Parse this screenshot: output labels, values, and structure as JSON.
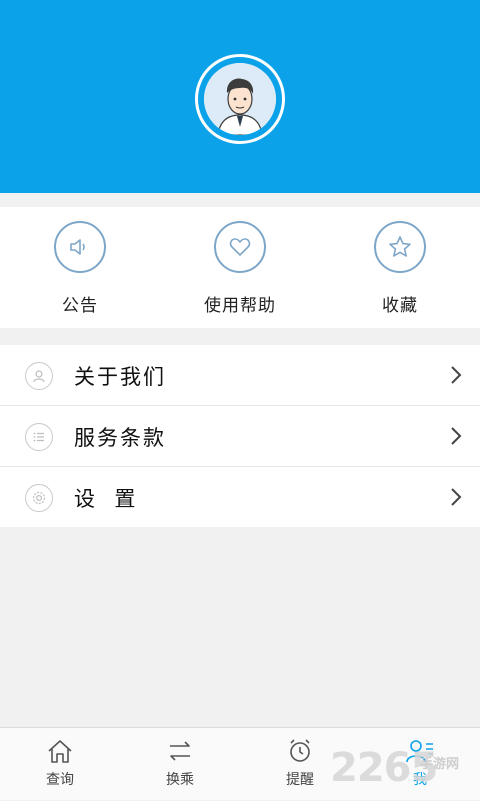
{
  "quick_actions": [
    {
      "label": "公告",
      "icon": "speaker-icon"
    },
    {
      "label": "使用帮助",
      "icon": "heart-icon"
    },
    {
      "label": "收藏",
      "icon": "star-icon"
    }
  ],
  "menu": [
    {
      "label": "关于我们",
      "icon": "about-icon"
    },
    {
      "label": "服务条款",
      "icon": "list-icon"
    },
    {
      "label": "设  置",
      "icon": "gear-icon"
    }
  ],
  "tabs": [
    {
      "label": "查询",
      "icon": "home-icon",
      "active": false
    },
    {
      "label": "换乘",
      "icon": "transfer-icon",
      "active": false
    },
    {
      "label": "提醒",
      "icon": "alarm-icon",
      "active": false
    },
    {
      "label": "我",
      "icon": "profile-icon",
      "active": true
    }
  ],
  "watermark": {
    "number": "2265",
    "site": "手游网"
  },
  "colors": {
    "header": "#0ba2ea",
    "accent": "#0ba2ea",
    "icon_stroke": "#7ea6c8"
  }
}
